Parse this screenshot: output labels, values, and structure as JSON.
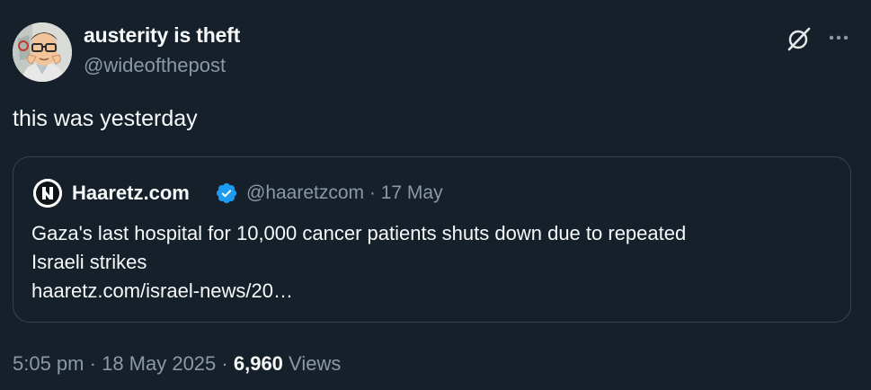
{
  "author": {
    "display_name": "austerity is theft",
    "handle": "@wideofthepost",
    "avatar_icon": "cartoon-character-avatar"
  },
  "actions": {
    "grok_icon": "grok-slash-circle-icon",
    "more_icon": "more-dots-icon"
  },
  "tweet": {
    "text": "this was yesterday"
  },
  "quoted": {
    "logo_icon": "haaretz-logo",
    "display_name": "Haaretz.com",
    "verified_icon": "verified-badge-icon",
    "handle": "@haaretzcom",
    "date": "17 May",
    "separator": "·",
    "text_lines": [
      "Gaza's last hospital for 10,000 cancer patients shuts down due to repeated",
      "Israeli strikes",
      "haaretz.com/israel-news/20…"
    ]
  },
  "meta": {
    "time": "5:05 pm",
    "date": "18 May 2025",
    "separator": "·",
    "views_count": "6,960",
    "views_label": "Views"
  },
  "colors": {
    "background": "#15202b",
    "primary_text": "#f7f9f9",
    "secondary_text": "#8b98a5",
    "border": "#38444d",
    "verified_blue": "#1d9bf0"
  }
}
